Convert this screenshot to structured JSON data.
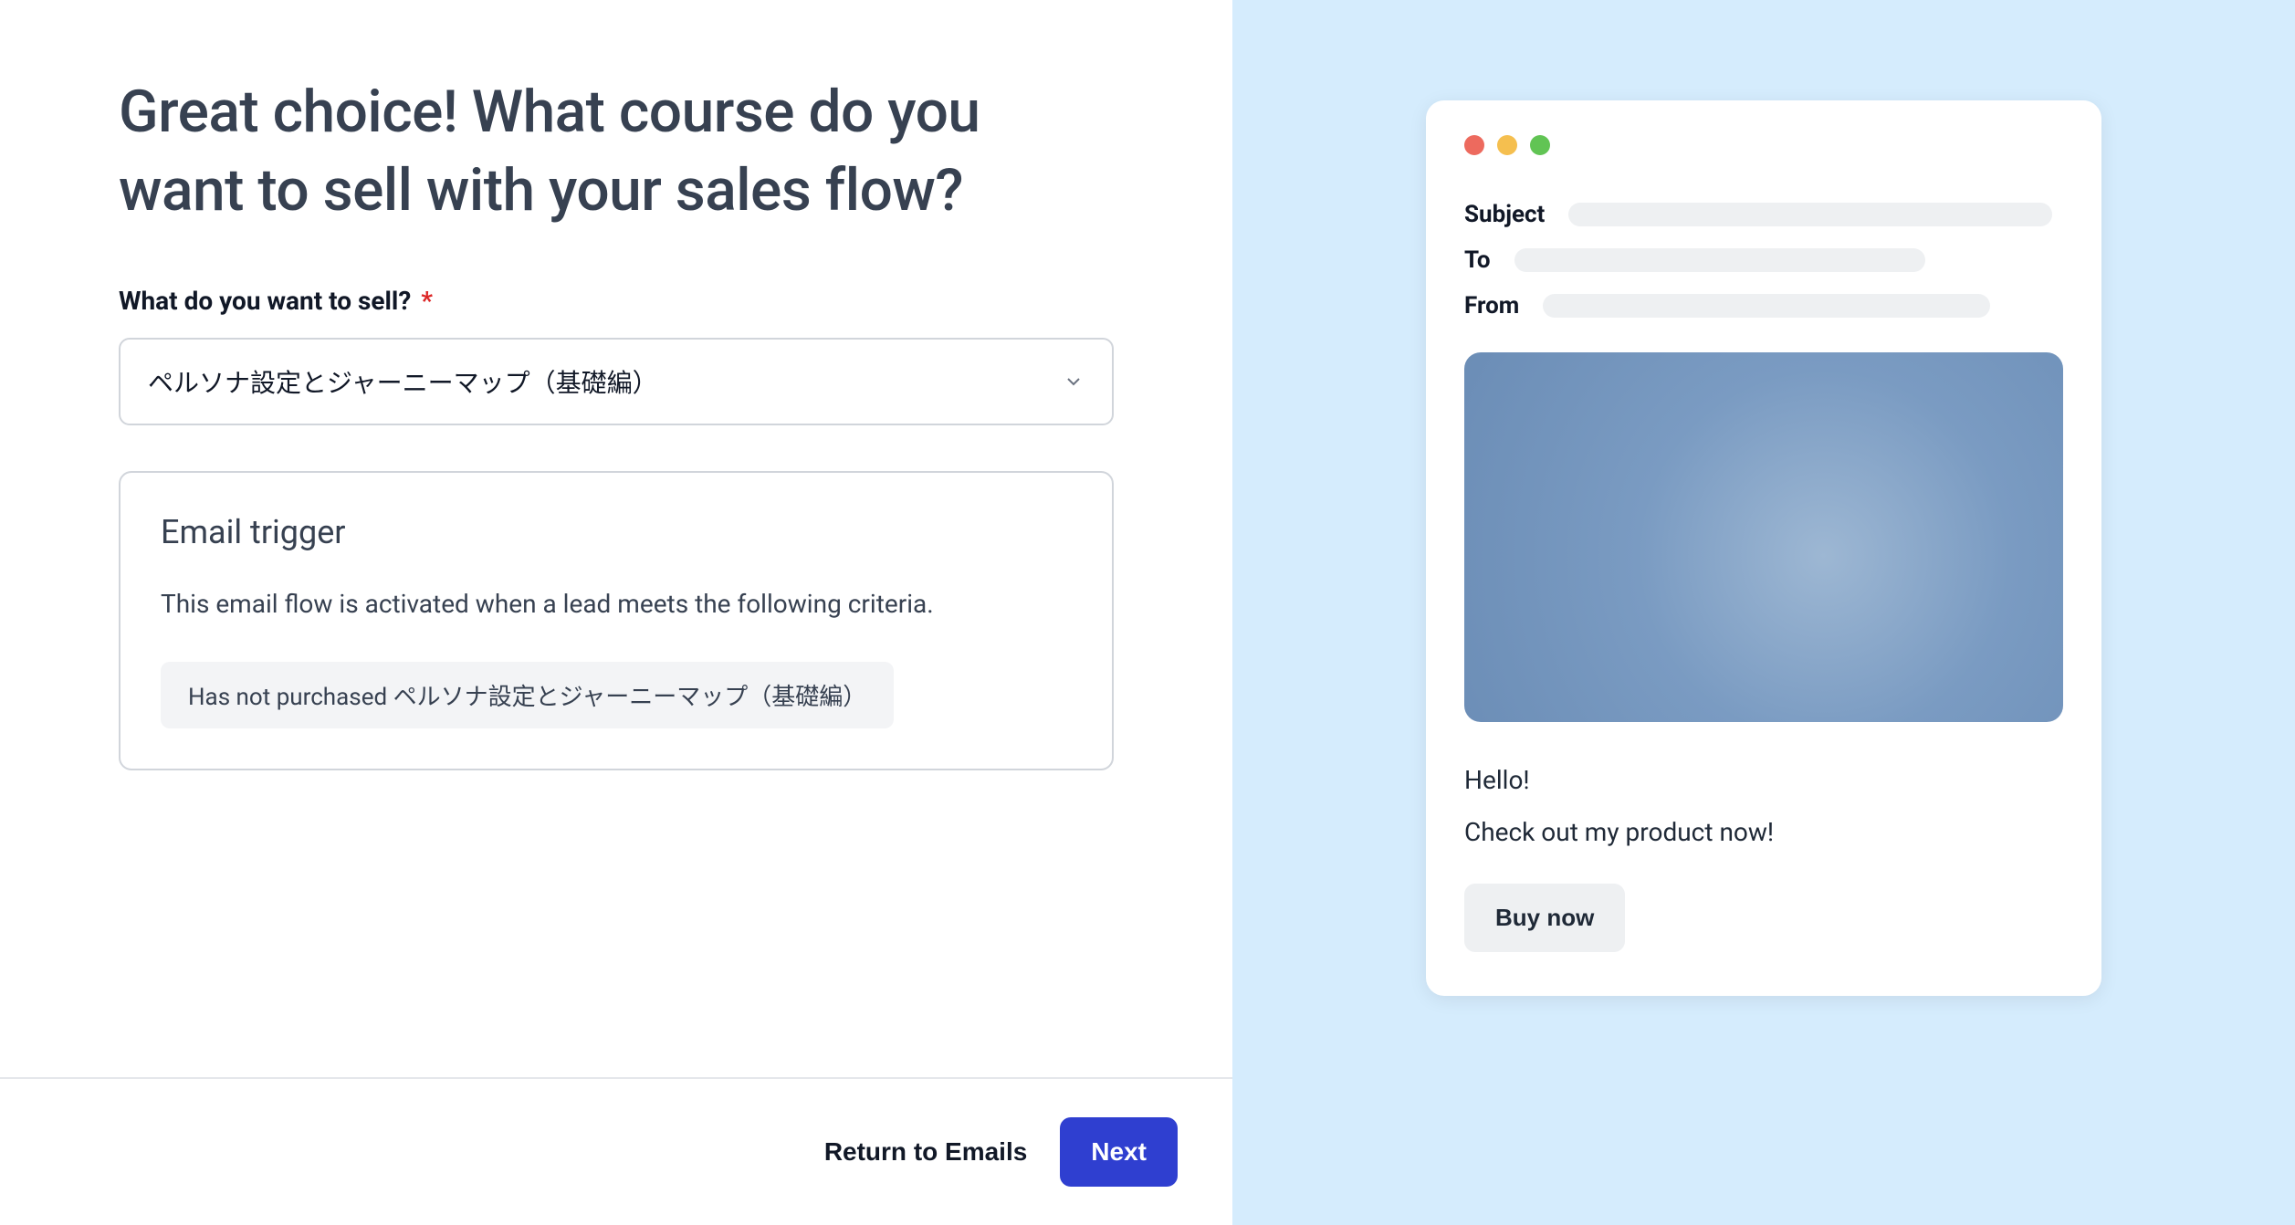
{
  "form": {
    "title": "Great choice! What course do you want to sell with your sales flow?",
    "field_label": "What do you want to sell?",
    "required_mark": "*",
    "select_value": "ペルソナ設定とジャーニーマップ（基礎編）",
    "trigger": {
      "title": "Email trigger",
      "description": "This email flow is activated when a lead meets the following criteria.",
      "condition": "Has not purchased ペルソナ設定とジャーニーマップ（基礎編）"
    },
    "footer": {
      "return_label": "Return to Emails",
      "next_label": "Next"
    }
  },
  "preview": {
    "subject_label": "Subject",
    "to_label": "To",
    "from_label": "From",
    "greeting": "Hello!",
    "body": "Check out my product now!",
    "cta_label": "Buy now"
  }
}
